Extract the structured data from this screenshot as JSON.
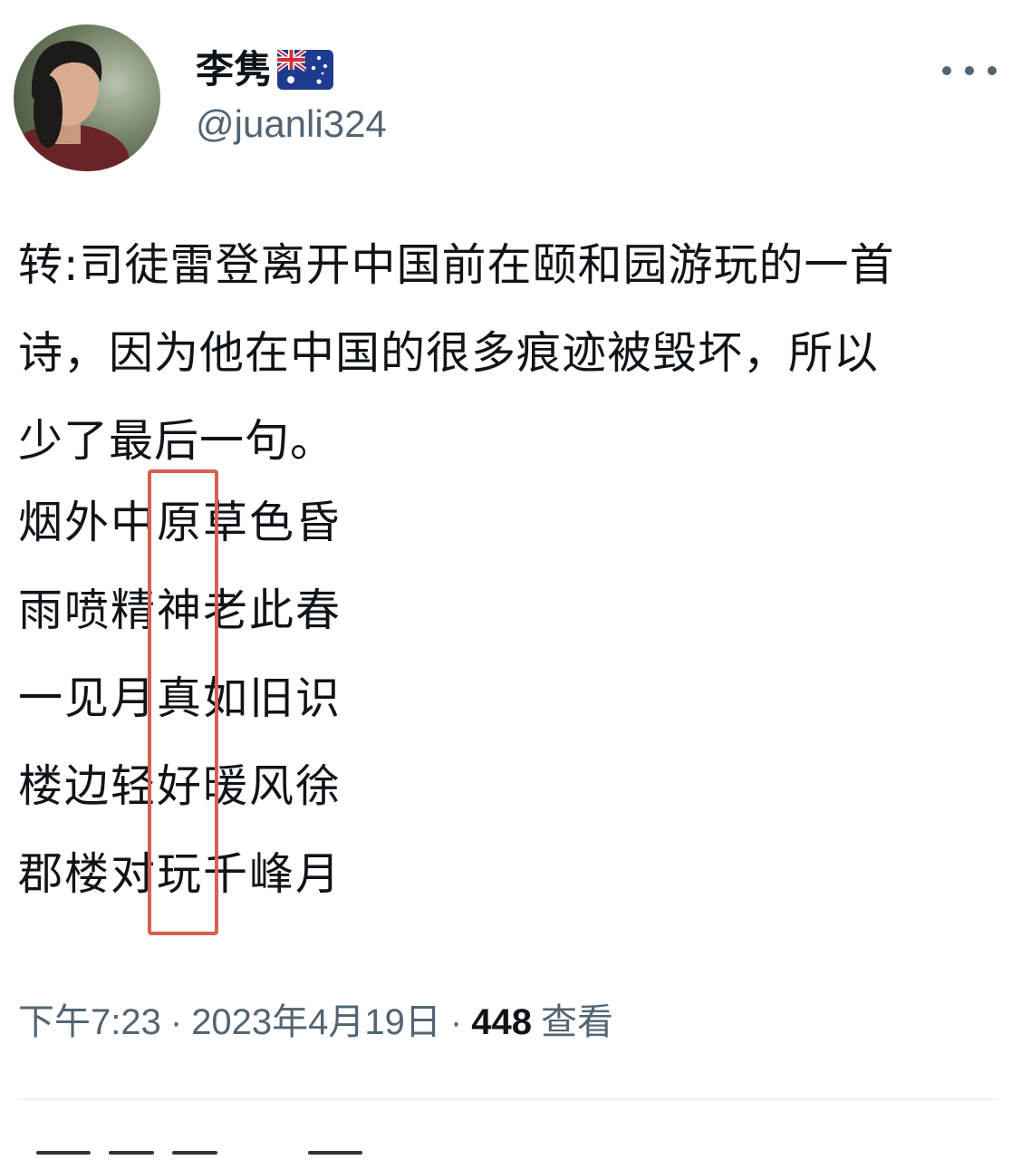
{
  "header": {
    "display_name": "李隽",
    "flag_icon": "australia-flag-icon",
    "handle": "@juanli324",
    "more_icon": "more-horizontal-icon"
  },
  "tweet": {
    "text_lines": [
      "转:司徒雷登离开中国前在颐和园游玩的一首",
      "诗，因为他在中国的很多痕迹被毁坏，所以",
      "少了最后一句。"
    ],
    "poem_lines": [
      "烟外中原草色昏",
      "雨喷精神老此春",
      "一见月真如旧识",
      "楼边轻好暖风徐",
      "郡楼对玩千峰月"
    ],
    "highlight_color": "#d9604f"
  },
  "meta": {
    "time": "下午7:23",
    "date": "2023年4月19日",
    "separator": "·",
    "views_count": "448",
    "views_label": "查看"
  }
}
